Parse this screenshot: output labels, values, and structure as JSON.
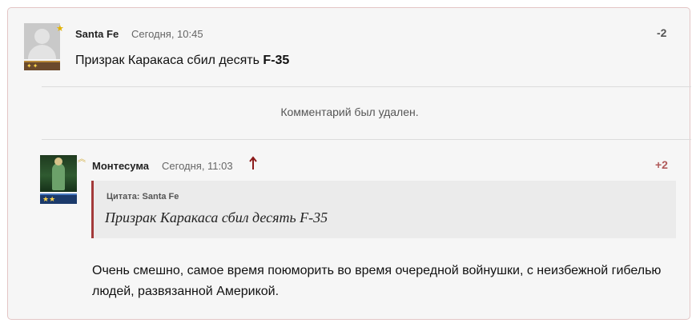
{
  "comments": [
    {
      "username": "Santa Fe",
      "time": "Сегодня, 10:45",
      "score": "-2",
      "text_prefix": "Призрак Каракаса сбил десять ",
      "text_bold": "F-35"
    },
    {
      "deleted_text": "Комментарий был удален."
    },
    {
      "username": "Монтесума",
      "time": "Сегодня, 11:03",
      "score": "+2",
      "quote_label": "Цитата: Santa Fe",
      "quote_text": "Призрак Каракаса сбил десять F-35",
      "text": "Очень смешно, самое время поюморить во время очередной войнушки, с неизбежной гибелью людей, развязанной Америкой."
    }
  ],
  "colors": {
    "score_negative": "#555555",
    "score_positive": "#b05a5a",
    "quote_border": "#a33a3a",
    "reply_arrow": "#8b1a1a"
  },
  "icons": [
    "star-icon",
    "rank-badge-icon",
    "chevron-rank-icon",
    "reply-arrow-icon"
  ]
}
